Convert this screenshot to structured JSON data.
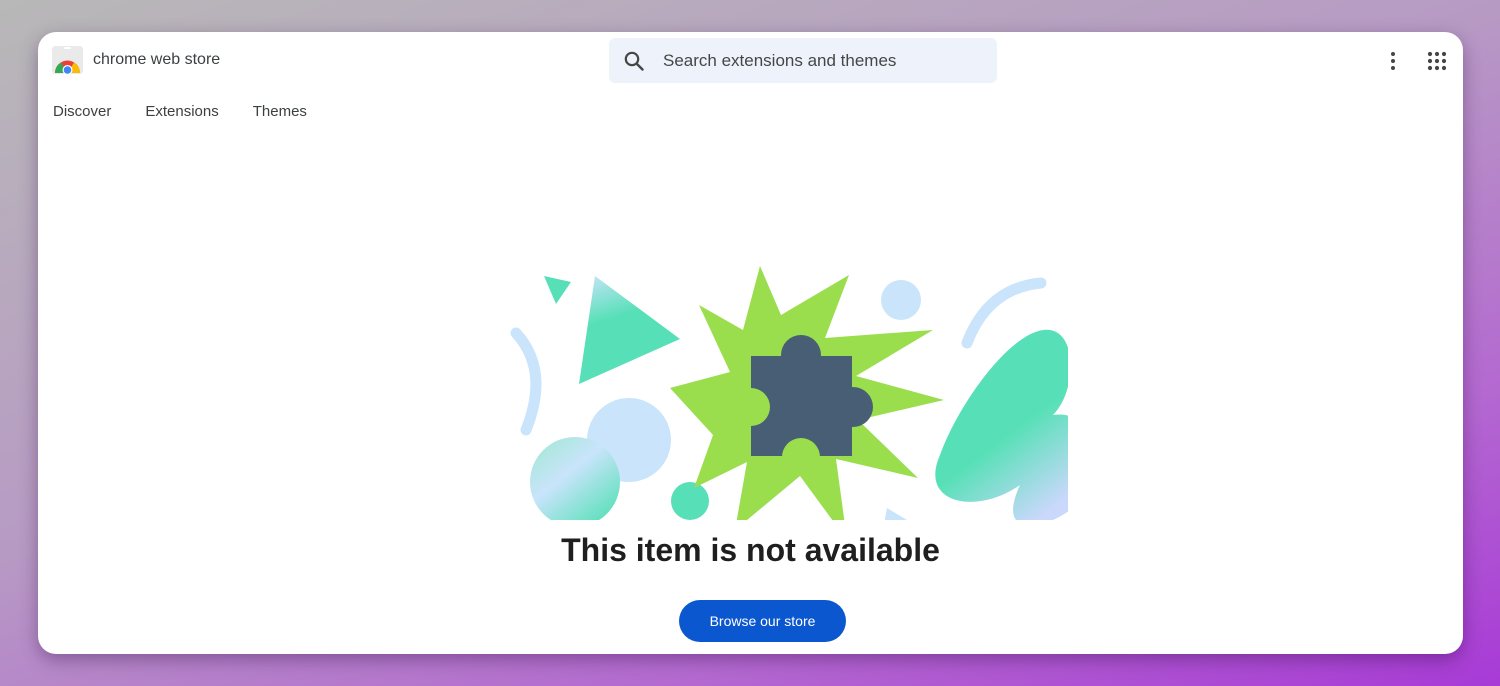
{
  "header": {
    "store_name": "chrome web store",
    "search_placeholder": "Search extensions and themes"
  },
  "nav": {
    "items": [
      {
        "label": "Discover"
      },
      {
        "label": "Extensions"
      },
      {
        "label": "Themes"
      }
    ]
  },
  "main": {
    "title": "This item is not available",
    "browse_button_label": "Browse our store"
  },
  "colors": {
    "accent": "#0b57d0",
    "starburst": "#9ade4e",
    "puzzle": "#475e74",
    "teal": "#57e0b7",
    "light_blue": "#c9e4fb"
  },
  "icons": {
    "search": "search-icon",
    "more": "more-vert-icon",
    "apps": "apps-grid-icon",
    "puzzle": "puzzle-piece-icon"
  }
}
